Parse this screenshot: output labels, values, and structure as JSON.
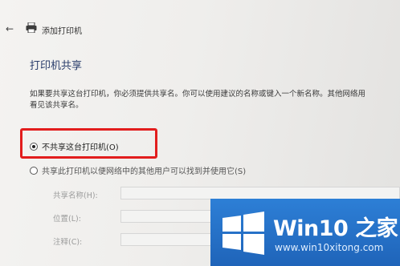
{
  "header": {
    "back_icon": "back-arrow-icon",
    "printer_icon": "printer-icon",
    "title": "添加打印机"
  },
  "section": {
    "title": "打印机共享",
    "description": "如果要共享这台打印机，你必须提供共享名。你可以使用建议的名称或键入一个新名称。其他网络用\n看见该共享名。"
  },
  "options": {
    "no_share": {
      "label": "不共享这台打印机(O)",
      "selected": true
    },
    "share": {
      "label": "共享此打印机以便网络中的其他用户可以找到并使用它(S)",
      "selected": false
    }
  },
  "fields": {
    "share_name": {
      "label": "共享名称(H):",
      "value": ""
    },
    "location": {
      "label": "位置(L):",
      "value": ""
    },
    "comment": {
      "label": "注释(C):",
      "value": ""
    }
  },
  "highlight_color": "#e21d1d",
  "watermark": {
    "brand": "Win10 之家",
    "url": "www.win10xitong.com"
  }
}
